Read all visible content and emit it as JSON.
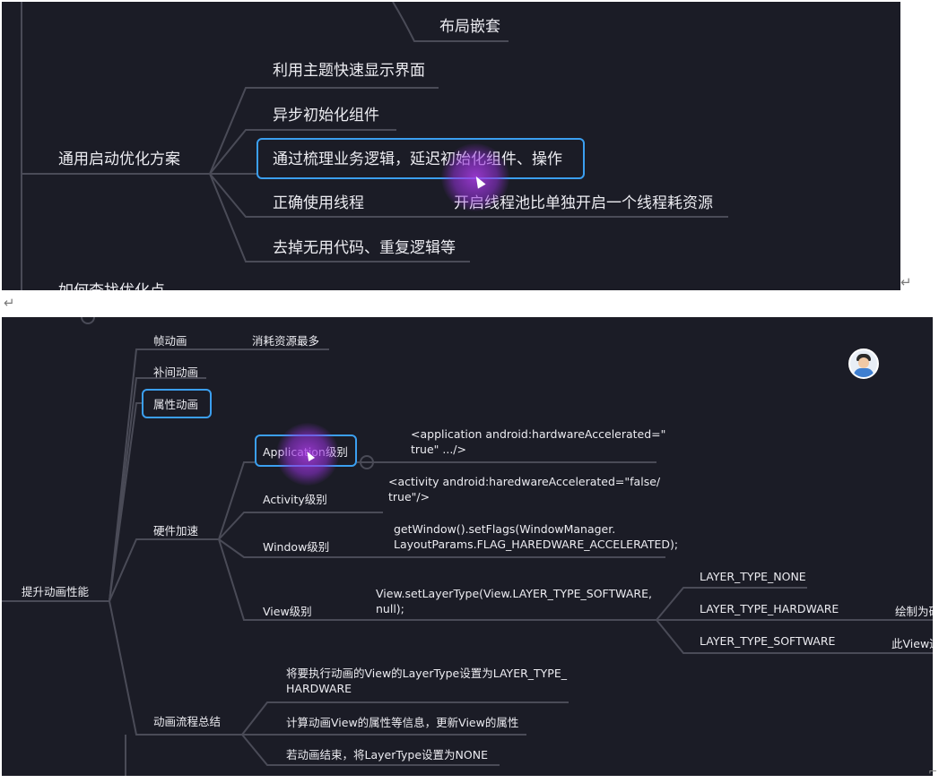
{
  "shot1": {
    "nodes": {
      "layout_nesting": "布局嵌套",
      "root_label": "通用启动优化方案",
      "child_1": "利用主题快速显示界面",
      "child_2": "异步初始化组件",
      "child_3": "通过梳理业务逻辑，延迟初始化组件、操作",
      "child_4": "正确使用线程",
      "child_4_note": "开启线程池比单独开启一个线程耗资源",
      "child_5": "去掉无用代码、重复逻辑等",
      "cut_label": "如何查找优化点"
    }
  },
  "shot2": {
    "root": "提升动画性能",
    "frame_anim": "帧动画",
    "frame_anim_note": "消耗资源最多",
    "tween_anim": "补间动画",
    "property_anim": "属性动画",
    "hw_accel": "硬件加速",
    "app_level": "Application级别",
    "app_code": "<application android:hardwareAccelerated=\"\ntrue\" .../>",
    "activity_level": "Activity级别",
    "activity_code": "<activity android:haredwareAccelerated=\"false/\ntrue\"/>",
    "window_level": "Window级别",
    "window_code": "getWindow().setFlags(WindowManager.\nLayoutParams.FLAG_HAREDWARE_ACCELERATED);",
    "view_level": "View级别",
    "view_code": "View.setLayerType(View.LAYER_TYPE_SOFTWARE,\nnull);",
    "layer_none": "LAYER_TYPE_NONE",
    "layer_hardware": "LAYER_TYPE_HARDWARE",
    "layer_hardware_note": "绘制为硬",
    "layer_software": "LAYER_TYPE_SOFTWARE",
    "layer_software_note": "此View通",
    "flow_summary": "动画流程总结",
    "flow_1": "将要执行动画的View的LayerType设置为LAYER_TYPE_\nHARDWARE",
    "flow_2": "计算动画View的属性等信息，更新View的属性",
    "flow_3": "若动画结束，将LayerType设置为NONE"
  },
  "doc": {
    "return_mark": "↵"
  },
  "colors": {
    "canvas": "#1b1c26",
    "line": "#4a4b57",
    "text": "#ececf1",
    "highlight": "#3b9ff0",
    "glow": "#a03ce6"
  },
  "icons": [
    "cursor-icon",
    "avatar-icon",
    "return-mark-icon"
  ]
}
